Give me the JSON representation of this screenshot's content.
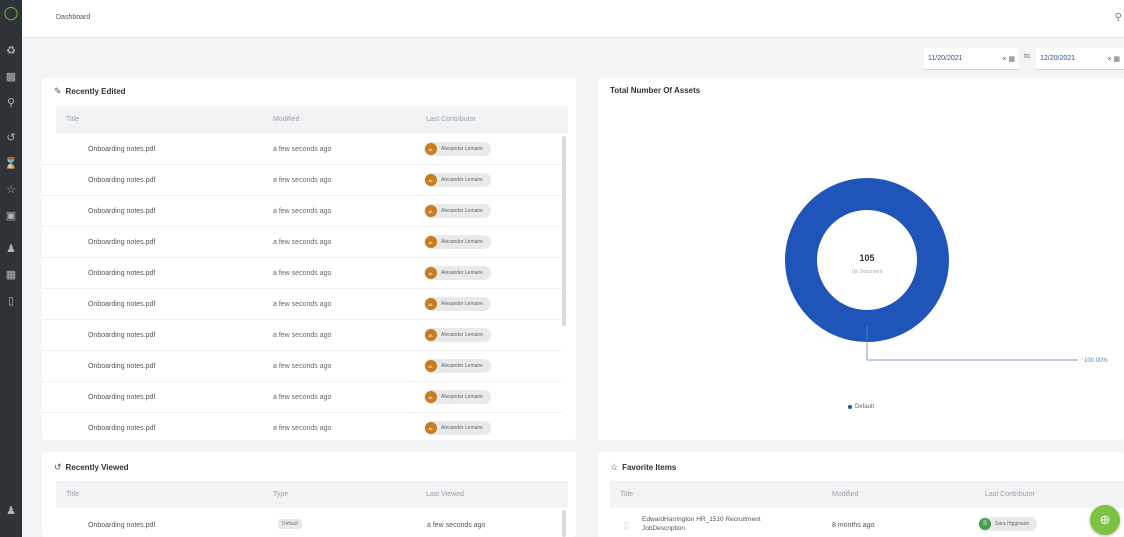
{
  "app": {
    "breadcrumb": "Dashboard",
    "accent": "#8cc63f",
    "sidebar_bg": "#2e3338"
  },
  "sidebar": {
    "icons": [
      "bulb-icon",
      "sitemap-icon",
      "document-icon",
      "search-icon",
      "history-icon",
      "hourglass-icon",
      "star-icon",
      "gallery-icon",
      "user-icon",
      "clipboard-icon",
      "trash-icon",
      "user-bottom-icon"
    ]
  },
  "dates": {
    "from": "11/20/2021",
    "to_label": "to",
    "to": "12/20/2021"
  },
  "recently_edited": {
    "title": "Recently Edited",
    "columns": [
      "Title",
      "Modified",
      "Last Contributor"
    ],
    "rows": [
      {
        "title": "Onboarding notes.pdf",
        "modified": "a few seconds ago",
        "contributor": "Alexander Lemaire"
      },
      {
        "title": "Onboarding notes.pdf",
        "modified": "a few seconds ago",
        "contributor": "Alexander Lemaire"
      },
      {
        "title": "Onboarding notes.pdf",
        "modified": "a few seconds ago",
        "contributor": "Alexander Lemaire"
      },
      {
        "title": "Onboarding notes.pdf",
        "modified": "a few seconds ago",
        "contributor": "Alexander Lemaire"
      },
      {
        "title": "Onboarding notes.pdf",
        "modified": "a few seconds ago",
        "contributor": "Alexander Lemaire"
      },
      {
        "title": "Onboarding notes.pdf",
        "modified": "a few seconds ago",
        "contributor": "Alexander Lemaire"
      },
      {
        "title": "Onboarding notes.pdf",
        "modified": "a few seconds ago",
        "contributor": "Alexander Lemaire"
      },
      {
        "title": "Onboarding notes.pdf",
        "modified": "a few seconds ago",
        "contributor": "Alexander Lemaire"
      },
      {
        "title": "Onboarding notes.pdf",
        "modified": "a few seconds ago",
        "contributor": "Alexander Lemaire"
      },
      {
        "title": "Onboarding notes.pdf",
        "modified": "a few seconds ago",
        "contributor": "Alexander Lemaire"
      }
    ]
  },
  "total_assets": {
    "title": "Total Number Of Assets",
    "center_value": "105",
    "center_label": "Up Document",
    "percent_label": "100.00%",
    "legend": "Default",
    "color": "#1f55b8"
  },
  "recently_viewed": {
    "title": "Recently Viewed",
    "columns": [
      "Title",
      "Type",
      "Last Viewed"
    ],
    "rows": [
      {
        "title": "Onboarding notes.pdf",
        "type": "Default",
        "viewed": "a few seconds ago"
      }
    ]
  },
  "favorite_items": {
    "title": "Favorite Items",
    "columns": [
      "Title",
      "Modified",
      "Last Contributor"
    ],
    "rows": [
      {
        "title_line1": "EdwardHarrington HR_1510 Recruitment",
        "title_line2": "JobDescription",
        "modified": "8 months ago",
        "contributor": "Sara Higginson"
      }
    ]
  }
}
